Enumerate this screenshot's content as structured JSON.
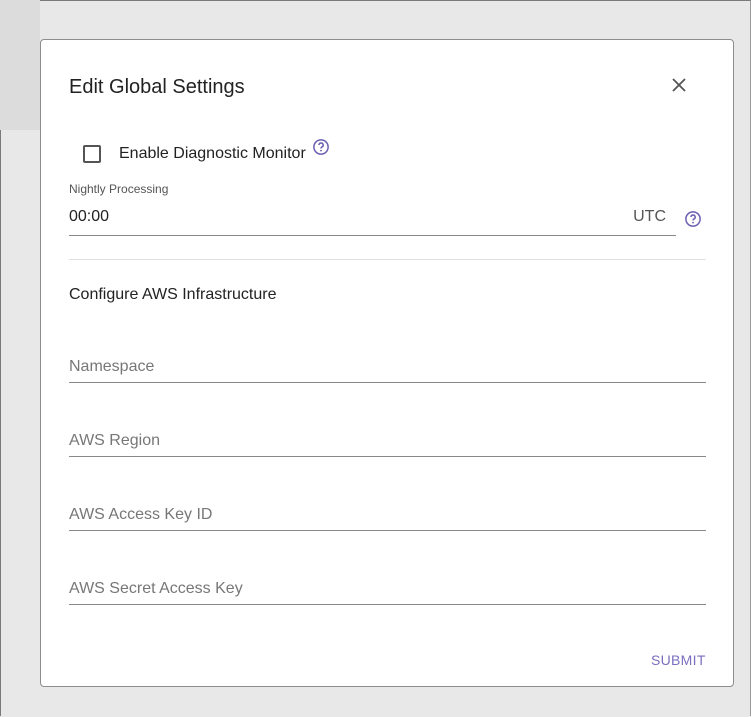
{
  "dialog": {
    "title": "Edit Global Settings",
    "close_icon": "close-icon",
    "diagnostic": {
      "label": "Enable Diagnostic Monitor",
      "checked": false,
      "help_icon": "help-circle-icon"
    },
    "nightly": {
      "label": "Nightly Processing",
      "value": "00:00",
      "timezone": "UTC",
      "help_icon": "help-circle-icon"
    },
    "aws": {
      "section_title": "Configure AWS Infrastructure",
      "namespace_placeholder": "Namespace",
      "region_placeholder": "AWS Region",
      "access_key_placeholder": "AWS Access Key ID",
      "secret_key_placeholder": "AWS Secret Access Key"
    },
    "submit_label": "SUBMIT"
  },
  "colors": {
    "accent": "#7a6fbf",
    "help_icon": "#6a5fb0",
    "background": "#e8e8e8"
  }
}
